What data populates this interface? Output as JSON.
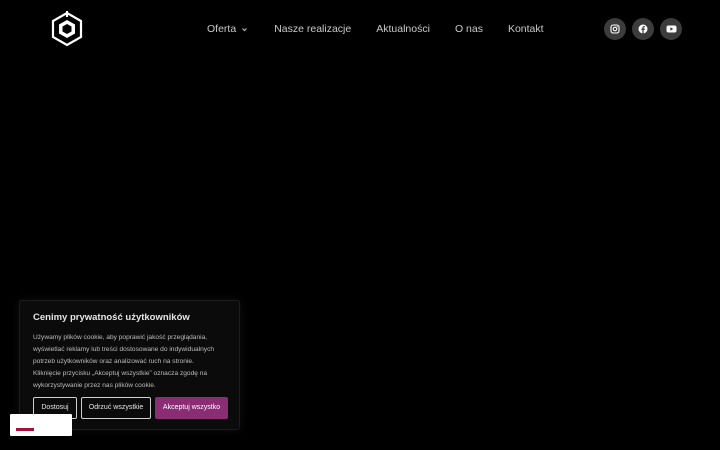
{
  "brand": {
    "logo_icon": "hexagon-cube-logo-icon",
    "colors": {
      "background": "#000000",
      "nav_text": "#c9c9c9",
      "social_bg": "#3c3c3c",
      "accent": "#8a2d74",
      "badge_accent": "#a01438"
    }
  },
  "nav": {
    "items": [
      {
        "label": "Oferta",
        "has_dropdown": true
      },
      {
        "label": "Nasze realizacje"
      },
      {
        "label": "Aktualności"
      },
      {
        "label": "O nas"
      },
      {
        "label": "Kontakt"
      }
    ]
  },
  "socials": [
    {
      "icon": "instagram-icon"
    },
    {
      "icon": "facebook-icon"
    },
    {
      "icon": "youtube-icon"
    }
  ],
  "cookie": {
    "title": "Cenimy prywatność użytkowników",
    "lines": [
      "Używamy plików cookie, aby poprawić jakość przeglądania,",
      "wyświetlać reklamy lub treści dostosowane do indywidualnych",
      "potrzeb użytkowników oraz analizować ruch na stronie.",
      "Kliknięcie przycisku „Akceptuj wszystkie” oznacza zgodę na",
      "wykorzystywanie przez nas plików cookie."
    ],
    "buttons": {
      "customize": "Dostosuj",
      "reject": "Odrzuć wszystkie",
      "accept": "Akceptuj wszystko"
    }
  }
}
